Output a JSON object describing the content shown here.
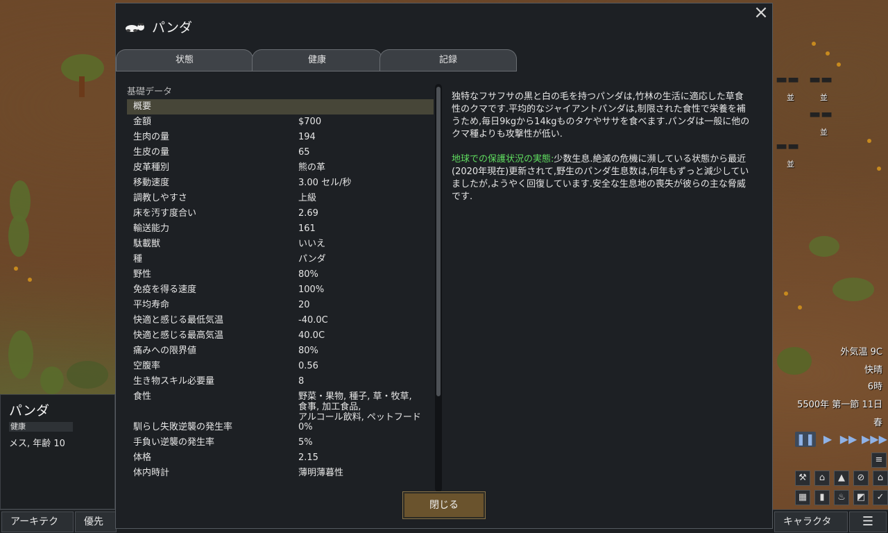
{
  "dialog": {
    "title": "パンダ",
    "icon": "panda-icon",
    "tabs": [
      "状態",
      "健康",
      "記録"
    ],
    "stats_header": "基礎データ",
    "stats": [
      {
        "label": "概要",
        "value": ""
      },
      {
        "label": "金額",
        "value": "$700"
      },
      {
        "label": "生肉の量",
        "value": "194"
      },
      {
        "label": "生皮の量",
        "value": "65"
      },
      {
        "label": "皮革種別",
        "value": "熊の革"
      },
      {
        "label": "移動速度",
        "value": "3.00 セル/秒"
      },
      {
        "label": "調教しやすさ",
        "value": "上級"
      },
      {
        "label": "床を汚す度合い",
        "value": "2.69"
      },
      {
        "label": "輸送能力",
        "value": "161"
      },
      {
        "label": "駄載獣",
        "value": "いいえ"
      },
      {
        "label": "種",
        "value": "パンダ"
      },
      {
        "label": "野性",
        "value": "80%"
      },
      {
        "label": "免疫を得る速度",
        "value": "100%"
      },
      {
        "label": "平均寿命",
        "value": "20"
      },
      {
        "label": "快適と感じる最低気温",
        "value": "-40.0C"
      },
      {
        "label": "快適と感じる最高気温",
        "value": "40.0C"
      },
      {
        "label": "痛みへの限界値",
        "value": "80%"
      },
      {
        "label": "空腹率",
        "value": "0.56"
      },
      {
        "label": "生き物スキル必要量",
        "value": "8"
      },
      {
        "label": "食性",
        "value": "野菜・果物, 種子, 草・牧草,\n食事, 加工食品,\nアルコール飲料, ペットフード"
      },
      {
        "label": "馴らし失敗逆襲の発生率",
        "value": "0%"
      },
      {
        "label": "手負い逆襲の発生率",
        "value": "5%"
      },
      {
        "label": "体格",
        "value": "2.15"
      },
      {
        "label": "体内時計",
        "value": "薄明薄暮性"
      }
    ],
    "description_1": "独特なフサフサの黒と白の毛を持つパンダは,竹林の生活に適応した草食性のクマです.平均的なジャイアントパンダは,制限された食性で栄養を補うため,毎日9kgから14kgものタケやササを食べます.パンダは一般に他のクマ種よりも攻撃性が低い.",
    "description_2_highlight": "地球での保護状況の実態:",
    "description_2_rest": "少数生息.絶滅の危機に瀕している状態から最近(2020年現在)更新されて,野生のパンダ生息数は,何年もずっと減少していましたが,ようやく回復しています.安全な生息地の喪失が彼らの主な脅威です.",
    "close_button": "閉じる",
    "close_icon": "×"
  },
  "pawn": {
    "name": "パンダ",
    "health": "健康",
    "desc": "メス, 年齢 10"
  },
  "bottom_bar": {
    "architect": "アーキテクト",
    "priority": "優先順",
    "character": "キャラクター",
    "menu_icon": "☰"
  },
  "hud": {
    "temperature": "外気温 9C",
    "weather": "快晴",
    "time": "6時",
    "date": "5500年 第一節 11日",
    "season": "春"
  },
  "map_weapons": [
    {
      "label": "並"
    },
    {
      "label": "並"
    },
    {
      "label": "並"
    },
    {
      "label": "並"
    }
  ],
  "colors": {
    "highlight_green": "#5fdc5f",
    "close_button": "#6a532d",
    "summary_row": "#474638"
  }
}
